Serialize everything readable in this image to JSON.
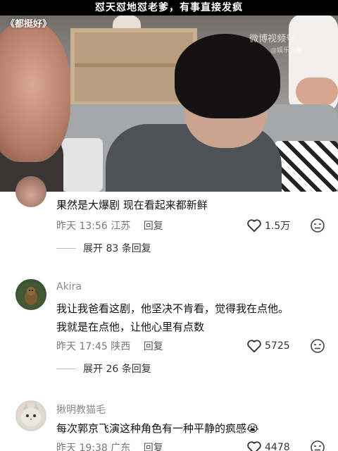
{
  "video": {
    "caption": "怼天怼地怼老爹，有事直接发疯",
    "show_tag": "《都挺好》",
    "watermark": "微博视频号",
    "watermark_sub": "@娱乐头条"
  },
  "comments": [
    {
      "username": "",
      "text": "果然是大爆剧  现在看起来都新鲜",
      "time": "昨天 13:56",
      "location": "江苏",
      "reply_label": "回复",
      "likes": "1.5万",
      "expand_label": "展开 83 条回复"
    },
    {
      "username": "Akira",
      "text_line1": "我让我爸看这剧，他坚决不肯看，觉得我在点他。",
      "text_line2": "我就是在点他，让他心里有点数",
      "time": "昨天 17:45",
      "location": "陕西",
      "reply_label": "回复",
      "likes": "5725",
      "expand_label": "展开 26 条回复"
    },
    {
      "username": "揪明教猫毛",
      "text": "每次郭京飞演这种角色有一种平静的疯感",
      "emoji": "😭",
      "time": "昨天 19:38",
      "location": "广东",
      "reply_label": "回复",
      "likes": "4478"
    }
  ],
  "icons": {
    "like": "heart-outline-icon",
    "dislike": "dislike-face-icon"
  }
}
